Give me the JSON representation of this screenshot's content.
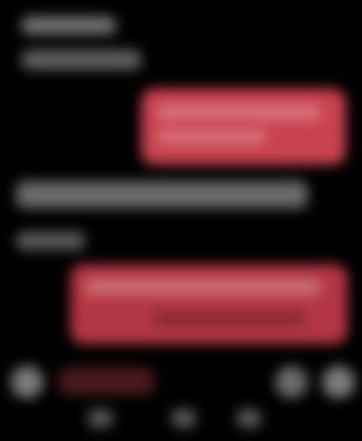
{
  "colors": {
    "background": "#000000",
    "accent_bubble": "#c9424f",
    "accent_bubble_dark": "#9c2d3c",
    "muted_text": "#6e6e6e"
  },
  "icons": {
    "attach": "plus-circle-icon",
    "emoji": "smile-icon",
    "send": "send-icon",
    "tab_1": "home-icon",
    "tab_2": "search-icon",
    "tab_3": "profile-icon"
  },
  "composer": {
    "placeholder": ""
  }
}
